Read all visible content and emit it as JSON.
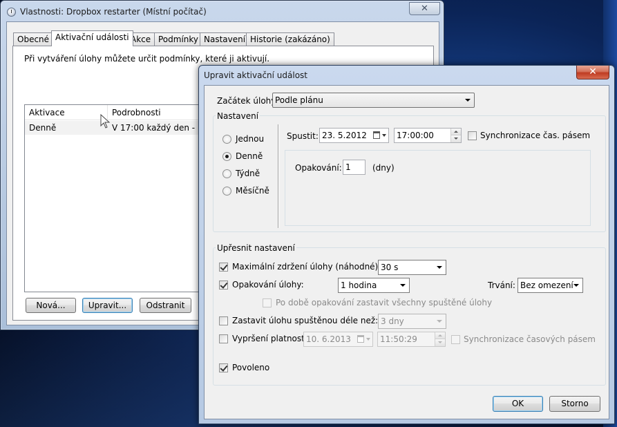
{
  "bg_window": {
    "title": "Vlastnosti: Dropbox restarter (Místní počítač)",
    "close_glyph": "✕",
    "tabs": [
      {
        "label": "Obecné",
        "active": false
      },
      {
        "label": "Aktivační události",
        "active": true
      },
      {
        "label": "Akce",
        "active": false
      },
      {
        "label": "Podmínky",
        "active": false
      },
      {
        "label": "Nastavení",
        "active": false
      },
      {
        "label": "Historie (zakázáno)",
        "active": false
      }
    ],
    "description": "Při vytváření úlohy můžete určit podmínky, které ji aktivují.",
    "list": {
      "columns": [
        "Aktivace",
        "Podrobnosti"
      ],
      "rows": [
        {
          "trigger": "Denně",
          "details": "V 17:00 každý den - Po a"
        }
      ]
    },
    "buttons": {
      "new": "Nová...",
      "edit": "Upravit...",
      "delete": "Odstranit"
    }
  },
  "dialog": {
    "title": "Upravit aktivační událost",
    "close_glyph": "✕",
    "begin_task_label": "Začátek úlohy:",
    "begin_task_value": "Podle plánu",
    "settings_group": "Nastavení",
    "schedule_options": [
      {
        "label": "Jednou",
        "selected": false
      },
      {
        "label": "Denně",
        "selected": true
      },
      {
        "label": "Týdně",
        "selected": false
      },
      {
        "label": "Měsíčně",
        "selected": false
      }
    ],
    "start_label": "Spustit:",
    "start_date": "23.  5.2012",
    "start_time": "17:00:00",
    "sync_timezones_label": "Synchronizace čas. pásem",
    "sync_timezones_checked": false,
    "recur_label": "Opakování:",
    "recur_value": "1",
    "recur_unit": "(dny)",
    "advanced_group": "Upřesnit nastavení",
    "delay": {
      "label": "Maximální zdržení úlohy (náhodné):",
      "checked": true,
      "value": "30 s"
    },
    "repeat": {
      "label": "Opakování úlohy:",
      "checked": true,
      "value": "1 hodina"
    },
    "duration": {
      "label": "Trvání:",
      "value": "Bez omezení"
    },
    "stop_all_label": "Po době opakování zastavit všechny spuštěné úlohy",
    "stop_all_checked": false,
    "stop_if_longer": {
      "label": "Zastavit úlohu spuštěnou déle než:",
      "checked": false,
      "value": "3 dny"
    },
    "expire": {
      "label": "Vypršení platnosti:",
      "checked": false,
      "date": "10.  6.2013",
      "time": "11:50:29",
      "sync_label": "Synchronizace časových pásem"
    },
    "enabled": {
      "label": "Povoleno",
      "checked": true
    },
    "ok_label": "OK",
    "cancel_label": "Storno"
  }
}
